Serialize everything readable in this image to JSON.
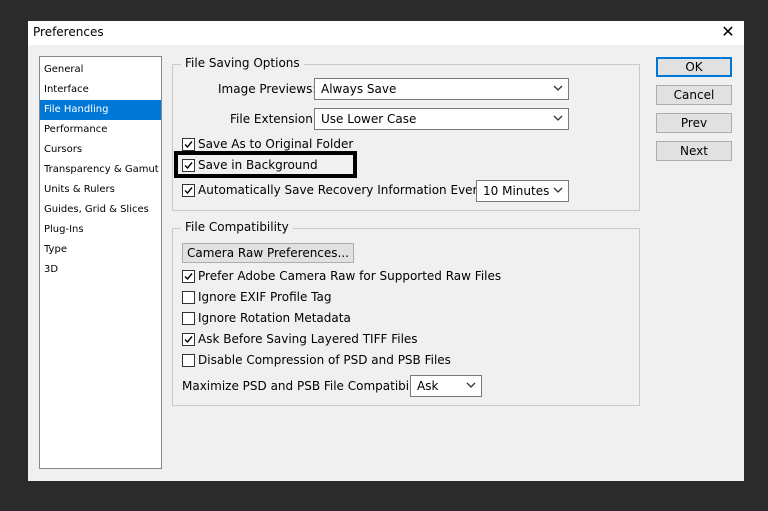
{
  "window": {
    "title": "Preferences"
  },
  "sidebar": {
    "items": [
      {
        "label": "General"
      },
      {
        "label": "Interface"
      },
      {
        "label": "File Handling",
        "selected": true
      },
      {
        "label": "Performance"
      },
      {
        "label": "Cursors"
      },
      {
        "label": "Transparency & Gamut"
      },
      {
        "label": "Units & Rulers"
      },
      {
        "label": "Guides, Grid & Slices"
      },
      {
        "label": "Plug-Ins"
      },
      {
        "label": "Type"
      },
      {
        "label": "3D"
      }
    ]
  },
  "file_saving": {
    "title": "File Saving Options",
    "image_previews": {
      "label": "Image Previews:",
      "value": "Always Save"
    },
    "file_extension": {
      "label": "File Extension:",
      "value": "Use Lower Case"
    },
    "save_as_original": {
      "label": "Save As to Original Folder",
      "checked": true
    },
    "save_in_background": {
      "label": "Save in Background",
      "checked": true
    },
    "auto_save": {
      "label": "Automatically Save Recovery Information Every:",
      "checked": true,
      "value": "10 Minutes"
    }
  },
  "file_compat": {
    "title": "File Compatibility",
    "camera_raw_button": "Camera Raw Preferences...",
    "prefer_acr": {
      "label": "Prefer Adobe Camera Raw for Supported Raw Files",
      "checked": true
    },
    "ignore_exif": {
      "label": "Ignore EXIF Profile Tag",
      "checked": false
    },
    "ignore_rotation": {
      "label": "Ignore Rotation Metadata",
      "checked": false
    },
    "ask_tiff": {
      "label": "Ask Before Saving Layered TIFF Files",
      "checked": true
    },
    "disable_compression": {
      "label": "Disable Compression of PSD and PSB Files",
      "checked": false
    },
    "maximize": {
      "label": "Maximize PSD and PSB File Compatibility:",
      "value": "Ask"
    }
  },
  "buttons": {
    "ok": "OK",
    "cancel": "Cancel",
    "prev": "Prev",
    "next": "Next"
  },
  "colors": {
    "accent": "#0078d7",
    "dialog_bg": "#f0f0f0",
    "backdrop": "#2b2b2b"
  }
}
